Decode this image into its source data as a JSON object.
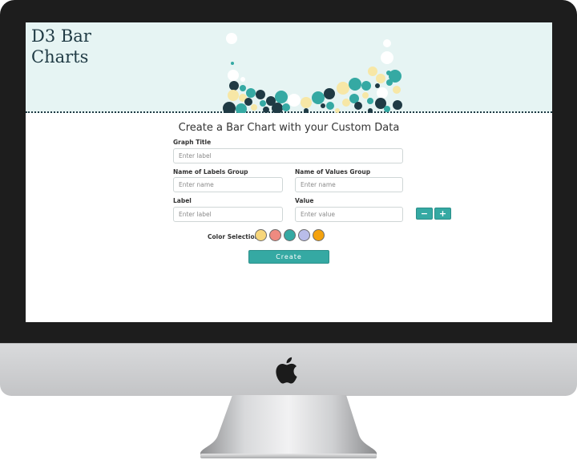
{
  "site": {
    "title_line1": "D3 Bar",
    "title_line2": "Charts"
  },
  "form": {
    "heading": "Create a Bar Chart with your Custom Data",
    "graph_title": {
      "label": "Graph Title",
      "placeholder": "Enter label"
    },
    "labels_group": {
      "label": "Name of Labels Group",
      "placeholder": "Enter name"
    },
    "values_group": {
      "label": "Name of Values Group",
      "placeholder": "Enter name"
    },
    "label_field": {
      "label": "Label",
      "placeholder": "Enter label"
    },
    "value_field": {
      "label": "Value",
      "placeholder": "Enter value"
    },
    "minus_label": "−",
    "plus_label": "+",
    "color_selection_label": "Color Selection",
    "colors": [
      "#f7d67a",
      "#ef8a80",
      "#35a9a3",
      "#b9bde9",
      "#f4a20d"
    ],
    "create_label": "Create"
  },
  "theme": {
    "accent": "#35a9a3",
    "hero_bg": "#e6f4f3",
    "dark": "#1f3a44",
    "bubble_colors": [
      "#1f3a44",
      "#35a9a3",
      "#f7e7a6",
      "#ffffff"
    ]
  }
}
